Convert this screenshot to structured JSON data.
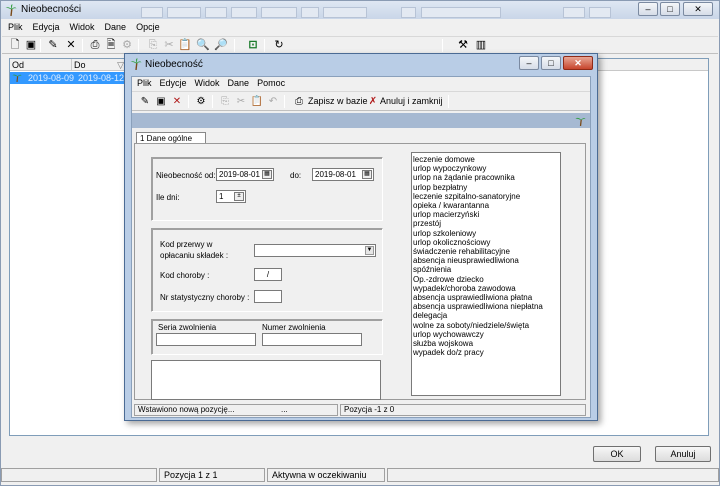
{
  "main_window": {
    "title": "Nieobecności",
    "menu": [
      "Plik",
      "Edycja",
      "Widok",
      "Dane",
      "Opcje"
    ],
    "grid_headers": [
      "Od",
      "Do"
    ],
    "selected_row": {
      "od": "2019-08-09",
      "do": "2019-08-12"
    },
    "ok_label": "OK",
    "cancel_label": "Anuluj",
    "status_position": "Pozycja 1 z 1",
    "status_state": "Aktywna w oczekiwaniu",
    "title_controls": {
      "minimize": "–",
      "maximize": "□",
      "close": "✕"
    },
    "funnel_glyph": "▽"
  },
  "dialog": {
    "title": "Nieobecność",
    "title_controls": {
      "minimize": "–",
      "maximize": "□",
      "close": "✕"
    },
    "menu": [
      "Plik",
      "Edycje",
      "Widok",
      "Dane",
      "Pomoc"
    ],
    "save_label": "Zapisz w bazie",
    "cancel_close_label": "Anuluj i zamknij",
    "tab_label": "1 Dane ogólne",
    "absence_from_label": "Nieobecność od:",
    "absence_from_value": "2019-08-01",
    "to_label": "do:",
    "to_value": "2019-08-01",
    "days_label": "Ile dni:",
    "days_value": "1",
    "break_code_label_1": "Kod przerwy w",
    "break_code_label_2": "opłacaniu składek :",
    "break_code_value": "",
    "illness_code_label": "Kod choroby :",
    "illness_code_value": "/",
    "stat_number_label": "Nr statystyczny choroby :",
    "stat_number_value": "",
    "sick_series_label": "Seria zwolnienia",
    "sick_number_label": "Numer zwolnienia",
    "absence_types": [
      "leczenie domowe",
      "urlop wypoczynkowy",
      "urlop na żądanie pracownika",
      "urlop bezpłatny",
      "leczenie szpitalno-sanatoryjne",
      "opieka / kwarantanna",
      "urlop macierzyński",
      "przestój",
      "urlop szkoleniowy",
      "urlop okolicznościowy",
      "świadczenie rehabilitacyjne",
      "absencja nieusprawiedliwiona",
      "spóźnienia",
      "Op.-zdrowe dziecko",
      "wypadek/choroba zawodowa",
      "absencja usprawiedliwiona płatna",
      "absencja usprawiedliwiona niepłatna",
      "delegacja",
      "wolne za soboty/niedziele/święta",
      "urlop wychowawczy",
      "służba wojskowa",
      "wypadek do/z pracy"
    ],
    "status_left": "Wstawiono nową pozycję...",
    "status_dots": "...",
    "status_right": "Pozycja -1 z 0"
  }
}
